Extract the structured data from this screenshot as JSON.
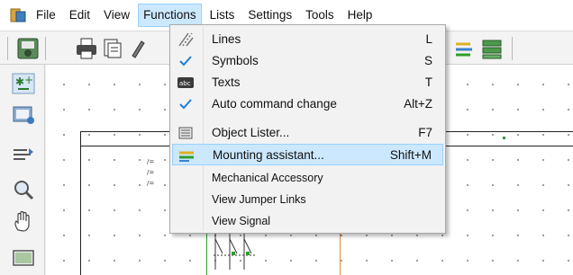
{
  "menubar": {
    "items": [
      {
        "label": "File"
      },
      {
        "label": "Edit"
      },
      {
        "label": "View"
      },
      {
        "label": "Functions"
      },
      {
        "label": "Lists"
      },
      {
        "label": "Settings"
      },
      {
        "label": "Tools"
      },
      {
        "label": "Help"
      }
    ],
    "active": "Functions"
  },
  "dropdown": {
    "items": [
      {
        "label": "Lines",
        "shortcut": "L",
        "icon": "lines-icon"
      },
      {
        "label": "Symbols",
        "shortcut": "S",
        "icon": "check-icon"
      },
      {
        "label": "Texts",
        "shortcut": "T",
        "icon": "abc-text-icon",
        "icon_text": "abc"
      },
      {
        "label": "Auto command change",
        "shortcut": "Alt+Z",
        "icon": "check-icon"
      },
      {
        "label": "Object Lister...",
        "shortcut": "F7",
        "icon": "list-icon"
      },
      {
        "label": "Mounting assistant...",
        "shortcut": "Shift+M",
        "icon": "mounting-rail-icon"
      },
      {
        "label": "Mechanical Accessory",
        "shortcut": ""
      },
      {
        "label": "View Jumper Links",
        "shortcut": ""
      },
      {
        "label": "View Signal",
        "shortcut": ""
      }
    ],
    "highlighted": "Mounting assistant..."
  },
  "colors": {
    "menu_highlight": "#cce8ff",
    "menu_highlight_border": "#99d1ff",
    "check_blue": "#1f7fd6",
    "wire_orange": "#e08a3c",
    "wire_green": "#2e9e2e"
  }
}
